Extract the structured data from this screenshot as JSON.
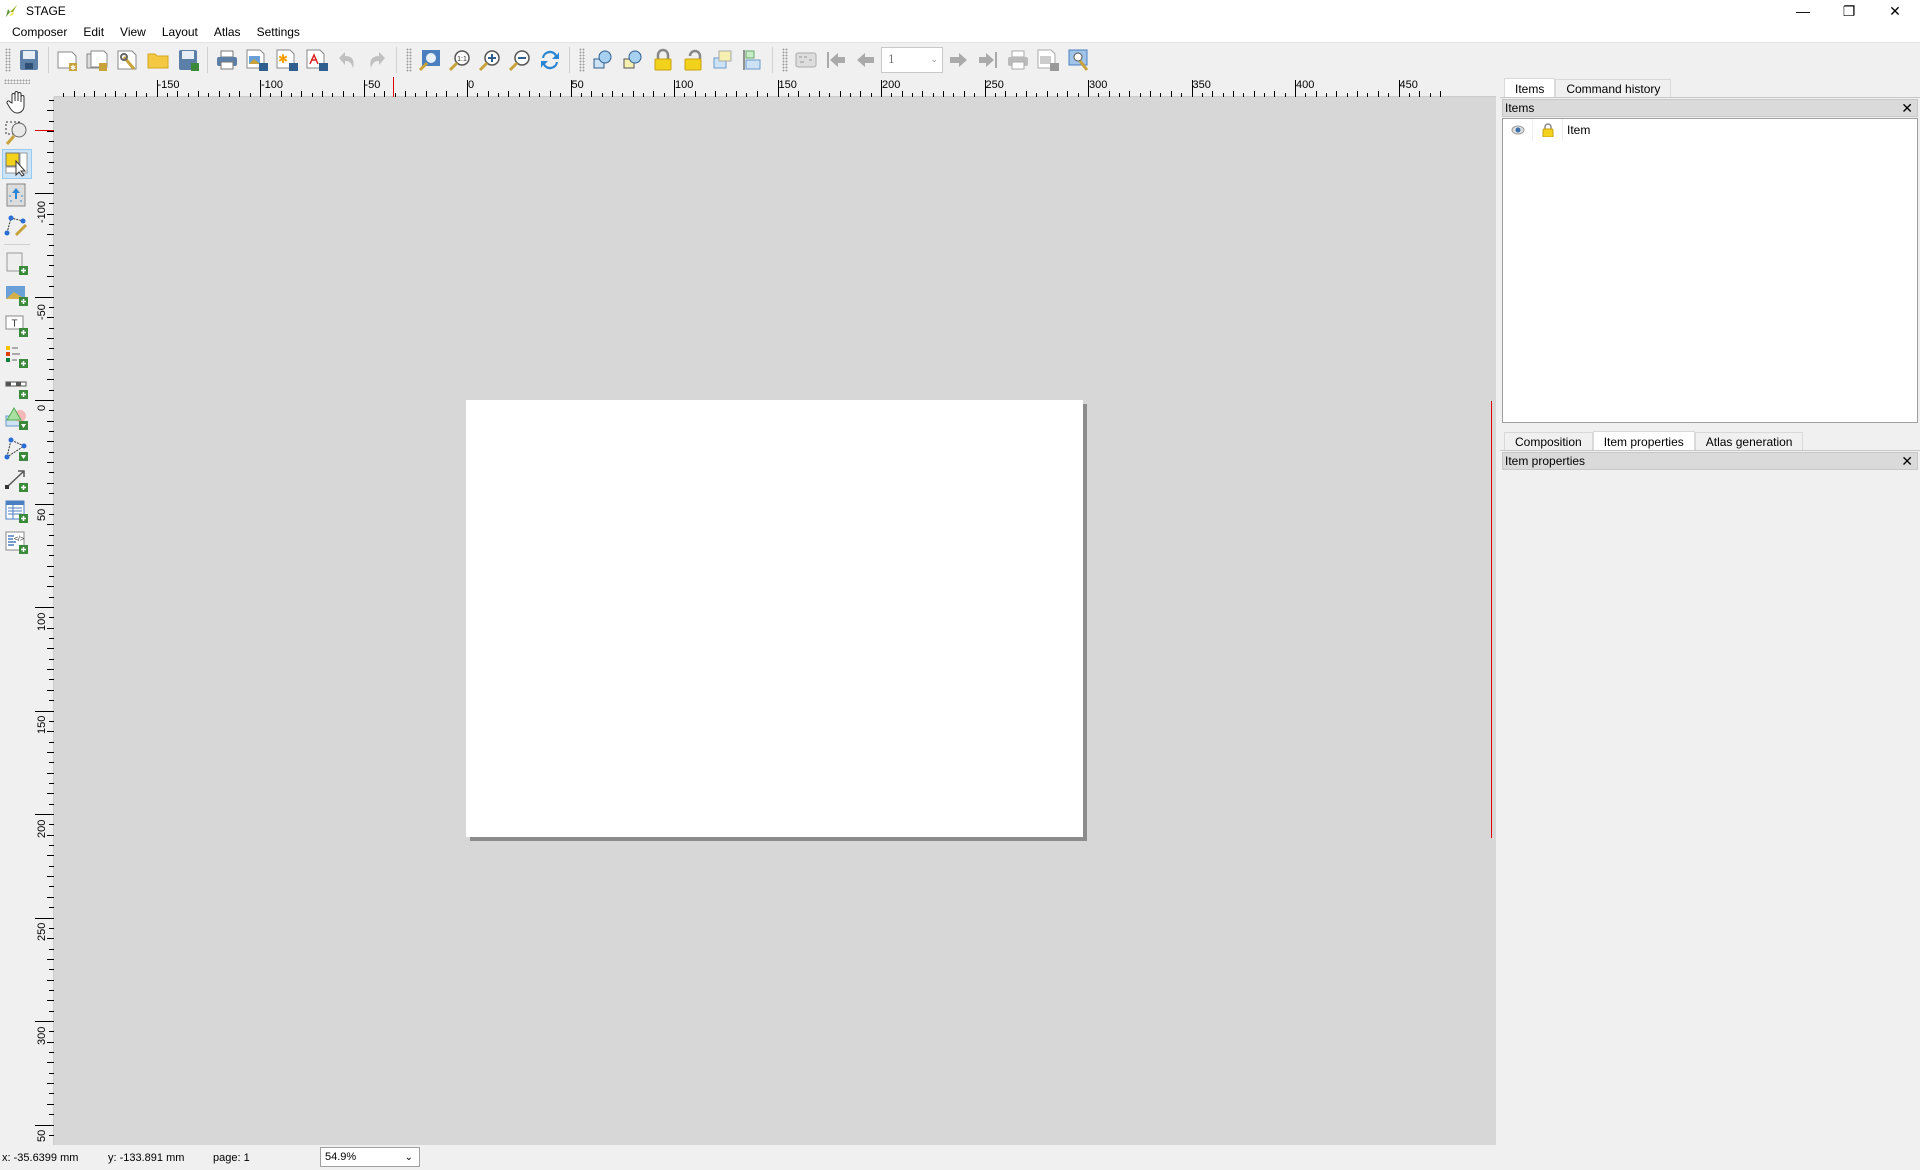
{
  "window": {
    "title": "STAGE",
    "controls": {
      "minimize": "—",
      "restore": "❐",
      "close": "✕"
    }
  },
  "menubar": {
    "items": [
      "Composer",
      "Edit",
      "View",
      "Layout",
      "Atlas",
      "Settings"
    ]
  },
  "toolbar": {
    "groups": [
      [
        "save-project",
        "new-composer",
        "duplicate-composer",
        "composer-manager",
        "open-template",
        "save-as-template"
      ],
      [
        "print",
        "export-image",
        "export-svg",
        "export-pdf",
        "undo",
        "redo"
      ],
      [
        "zoom-full",
        "zoom-actual",
        "zoom-in",
        "zoom-out",
        "refresh"
      ],
      [
        "group-items",
        "ungroup-items",
        "lock-items",
        "unlock-items",
        "raise-items",
        "align-items"
      ],
      [
        "atlas-preview",
        "atlas-first",
        "atlas-previous",
        "atlas-page",
        "atlas-next",
        "atlas-last",
        "atlas-print",
        "atlas-export",
        "atlas-settings"
      ]
    ],
    "atlas_page_value": "1"
  },
  "left_toolbar": {
    "tools": [
      "pan",
      "zoom",
      "select-move-item",
      "move-item-content",
      "edit-nodes",
      "add-map",
      "add-image",
      "add-label",
      "add-legend",
      "add-scalebar",
      "add-shape",
      "add-node-item",
      "add-arrow",
      "add-attribute-table",
      "add-html-frame"
    ],
    "active_tool": "select-move-item"
  },
  "rulers": {
    "horizontal_labels": [
      "-150",
      "-100",
      "-50",
      "0",
      "50",
      "100",
      "150",
      "200",
      "250",
      "300",
      "350",
      "400",
      "450"
    ],
    "vertical_labels": [
      "-100",
      "-50",
      "0",
      "50",
      "100",
      "150",
      "200",
      "250",
      "300",
      "50"
    ]
  },
  "dock": {
    "top_tabs": [
      {
        "label": "Items",
        "active": true
      },
      {
        "label": "Command history",
        "active": false
      }
    ],
    "items_panel": {
      "title": "Items",
      "close": "✕",
      "rows": [
        {
          "visible": true,
          "locked": true,
          "name": "Item"
        }
      ]
    },
    "bottom_tabs": [
      {
        "label": "Composition",
        "active": false
      },
      {
        "label": "Item properties",
        "active": true
      },
      {
        "label": "Atlas generation",
        "active": false
      }
    ],
    "properties_panel": {
      "title": "Item properties",
      "close": "✕"
    }
  },
  "statusbar": {
    "x": "x: -35.6399 mm",
    "y": "y: -133.891 mm",
    "page": "page: 1",
    "zoom": "54.9%"
  }
}
